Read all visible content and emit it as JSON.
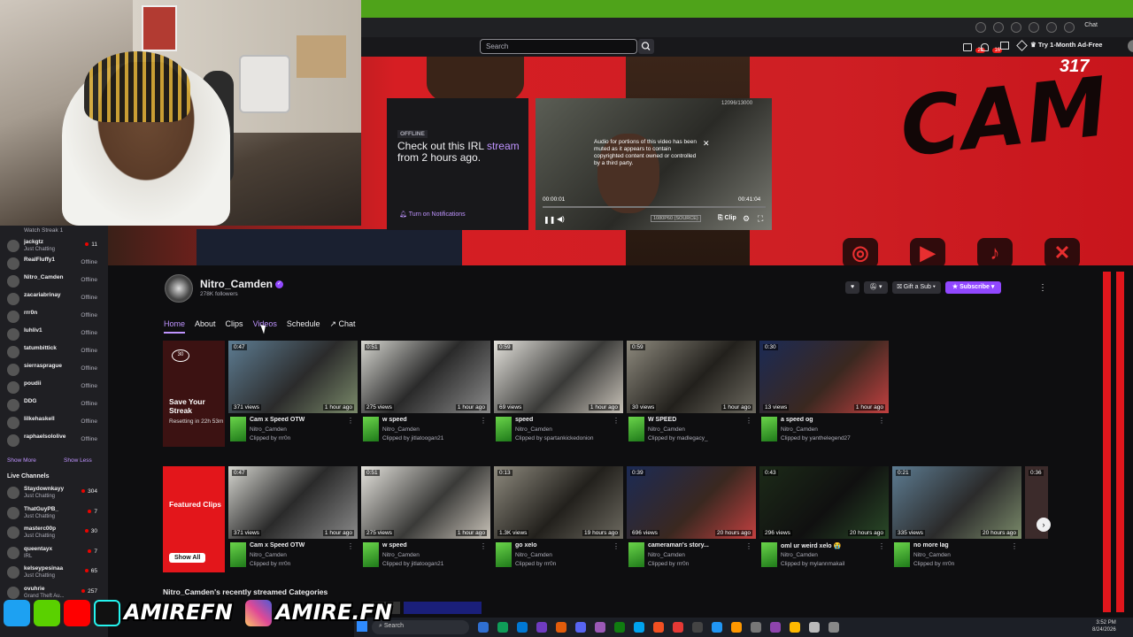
{
  "header": {
    "search_placeholder": "Search",
    "notif_count_1": "24",
    "notif_count_2": "16",
    "adfree_label": "Try 1-Month Ad-Free",
    "chat_label": "Chat"
  },
  "offline": {
    "badge": "OFFLINE",
    "msg_pre": "Check out this IRL ",
    "msg_link": "stream",
    "msg_post": " from 2 hours ago.",
    "turn_on": "Turn on Notifications"
  },
  "mini_player": {
    "muted_msg": "Audio for portions of this video has been muted as it appears to contain copyrighted content owned or controlled by a third party.",
    "time_current": "00:00:01",
    "time_total": "00:41:04",
    "progress": 0.0,
    "quality": "1080P60 (SOURCE)",
    "clip_label": "Clip",
    "counter": "12096/13000"
  },
  "banner": {
    "big_text": "CAM",
    "corner_text": "317"
  },
  "sidebar": {
    "top_text": "Watch Streak 1",
    "followed": [
      {
        "name": "jackgtz",
        "sub": "Just Chatting",
        "status": "11",
        "live": true
      },
      {
        "name": "RealFluffy1",
        "sub": "",
        "status": "Offline",
        "live": false
      },
      {
        "name": "Nitro_Camden",
        "sub": "",
        "status": "Offline",
        "live": false
      },
      {
        "name": "zacariabrinay",
        "sub": "",
        "status": "Offline",
        "live": false
      },
      {
        "name": "rrr0n",
        "sub": "",
        "status": "Offline",
        "live": false
      },
      {
        "name": "luhliv1",
        "sub": "",
        "status": "Offline",
        "live": false
      },
      {
        "name": "tatumbittick",
        "sub": "",
        "status": "Offline",
        "live": false
      },
      {
        "name": "sierrasprague",
        "sub": "",
        "status": "Offline",
        "live": false
      },
      {
        "name": "poudii",
        "sub": "",
        "status": "Offline",
        "live": false
      },
      {
        "name": "DDG",
        "sub": "",
        "status": "Offline",
        "live": false
      },
      {
        "name": "lilkehaskell",
        "sub": "",
        "status": "Offline",
        "live": false
      },
      {
        "name": "raphaelsololive",
        "sub": "",
        "status": "Offline",
        "live": false
      }
    ],
    "show_more": "Show More",
    "show_less": "Show Less",
    "live_title": "Live Channels",
    "live": [
      {
        "name": "Staydownkayy",
        "sub": "Just Chatting",
        "status": "304"
      },
      {
        "name": "ThatGuyPB_",
        "sub": "Just Chatting",
        "status": "7"
      },
      {
        "name": "masterc00p",
        "sub": "Just Chatting",
        "status": "30"
      },
      {
        "name": "queentayx",
        "sub": "IRL",
        "status": "7"
      },
      {
        "name": "kelseypesinaa",
        "sub": "Just Chatting",
        "status": "65"
      },
      {
        "name": "ovuhrie",
        "sub": "Grand Theft Au...",
        "status": "257"
      }
    ]
  },
  "channel": {
    "name": "Nitro_Camden",
    "followers": "278K followers",
    "gift_label": "Gift a Sub",
    "subscribe_label": "Subscribe",
    "tabs": [
      "Home",
      "About",
      "Clips",
      "Videos",
      "Schedule",
      "Chat"
    ]
  },
  "row1_special": {
    "title": "Save Your Streak",
    "sub": "Resetting in 22h 53m",
    "icon": "30"
  },
  "row2_special": {
    "title": "Featured Clips",
    "button": "Show All"
  },
  "row1": [
    {
      "dur": "0:47",
      "views": "371 views",
      "ago": "1 hour ago",
      "title": "Cam x Speed OTW",
      "chan": "Nitro_Camden",
      "by": "Clipped by rrr0n"
    },
    {
      "dur": "0:51",
      "views": "275 views",
      "ago": "1 hour ago",
      "title": "w speed",
      "chan": "Nitro_Camden",
      "by": "Clipped by jitlatoogan21"
    },
    {
      "dur": "0:59",
      "views": "69 views",
      "ago": "1 hour ago",
      "title": "speed",
      "chan": "Nitro_Camden",
      "by": "Clipped by spartankickedonion"
    },
    {
      "dur": "0:59",
      "views": "30 views",
      "ago": "1 hour ago",
      "title": "W SPEED",
      "chan": "Nitro_Camden",
      "by": "Clipped by madlegacy_"
    },
    {
      "dur": "0:30",
      "views": "13 views",
      "ago": "1 hour ago",
      "title": "a speed og",
      "chan": "Nitro_Camden",
      "by": "Clipped by yanthelegend27"
    }
  ],
  "row2": [
    {
      "dur": "0:47",
      "views": "371 views",
      "ago": "1 hour ago",
      "title": "Cam x Speed OTW",
      "chan": "Nitro_Camden",
      "by": "Clipped by rrr0n"
    },
    {
      "dur": "0:51",
      "views": "275 views",
      "ago": "1 hour ago",
      "title": "w speed",
      "chan": "Nitro_Camden",
      "by": "Clipped by jitlatoogan21"
    },
    {
      "dur": "0:13",
      "views": "1.3K views",
      "ago": "19 hours ago",
      "title": "go xelo",
      "chan": "Nitro_Camden",
      "by": "Clipped by rrr0n"
    },
    {
      "dur": "0:39",
      "views": "696 views",
      "ago": "20 hours ago",
      "title": "cameraman's story...",
      "chan": "Nitro_Camden",
      "by": "Clipped by rrr0n"
    },
    {
      "dur": "0:43",
      "views": "296 views",
      "ago": "20 hours ago",
      "title": "oml ur weird xelo 😭",
      "chan": "Nitro_Camden",
      "by": "Clipped by mylannmakail"
    },
    {
      "dur": "0:21",
      "views": "335 views",
      "ago": "20 hours ago",
      "title": "no more lag",
      "chan": "Nitro_Camden",
      "by": "Clipped by rrr0n"
    }
  ],
  "row2_partial": {
    "dur": "0:36"
  },
  "recent_categories": "Nitro_Camden's recently streamed Categories",
  "watermark": {
    "twitter_handle": "AMIREFN",
    "instagram_handle": "AMIRE.FN"
  },
  "taskbar": {
    "search": "Search",
    "time": "3:52 PM",
    "date": "8/24/2026"
  },
  "colors": {
    "accent": "#9147ff",
    "accent_light": "#bf94ff",
    "live_red": "#eb0400",
    "bg": "#0e0e10",
    "brand_red": "#e3161b"
  },
  "icons": [
    "search-icon",
    "heart-icon",
    "bell-icon",
    "gift-icon",
    "star-icon",
    "kebab-icon",
    "chevron-right-icon",
    "instagram-icon",
    "tiktok-icon",
    "x-icon",
    "youtube-icon",
    "twitter-icon"
  ]
}
